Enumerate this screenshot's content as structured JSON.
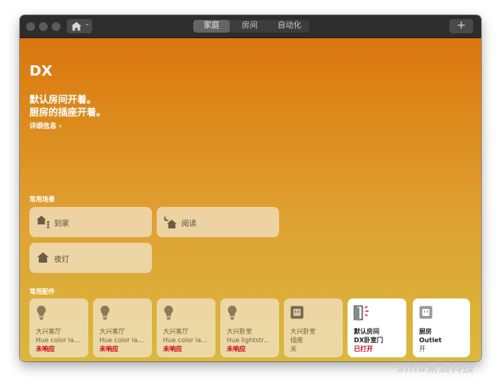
{
  "toolbar": {
    "tabs": [
      {
        "label": "家庭",
        "active": true
      },
      {
        "label": "房间",
        "active": false
      },
      {
        "label": "自动化",
        "active": false
      }
    ],
    "add_label": "+"
  },
  "home": {
    "name": "DX",
    "status_line1": "默认房间开着。",
    "status_line2": "厨房的插座开着。",
    "details_label": "详细信息 ›"
  },
  "scenes": {
    "header": "常用场景",
    "items": [
      {
        "label": "到家",
        "icon": "arrive-home-icon"
      },
      {
        "label": "阅读",
        "icon": "reading-scene-icon"
      },
      {
        "label": "夜灯",
        "icon": "night-light-icon"
      }
    ]
  },
  "accessories": {
    "header": "常用配件",
    "items": [
      {
        "room": "大兴客厅",
        "name": "Hue color la...",
        "state": "未响应",
        "icon": "lightbulb-icon"
      },
      {
        "room": "大兴客厅",
        "name": "Hue color la...",
        "state": "未响应",
        "icon": "lightbulb-icon"
      },
      {
        "room": "大兴客厅",
        "name": "Hue color la...",
        "state": "未响应",
        "icon": "lightbulb-icon"
      },
      {
        "room": "大兴卧室",
        "name": "Hue lightstr...",
        "state": "未响应",
        "icon": "lightbulb-icon"
      },
      {
        "room": "大兴卧室",
        "name": "插座",
        "state": "关",
        "icon": "outlet-icon"
      },
      {
        "room": "默认房间",
        "name": "DX卧室门",
        "state": "已打开",
        "icon": "door-open-icon"
      },
      {
        "room": "厨房",
        "name": "Outlet",
        "state": "开",
        "icon": "outlet-icon"
      }
    ]
  },
  "watermark": "sina新浪科技",
  "colors": {
    "gradient_top": "#d9700b",
    "gradient_bottom": "#dab83d",
    "error_red": "#d0021b",
    "titlebar": "#2d2d2d"
  }
}
